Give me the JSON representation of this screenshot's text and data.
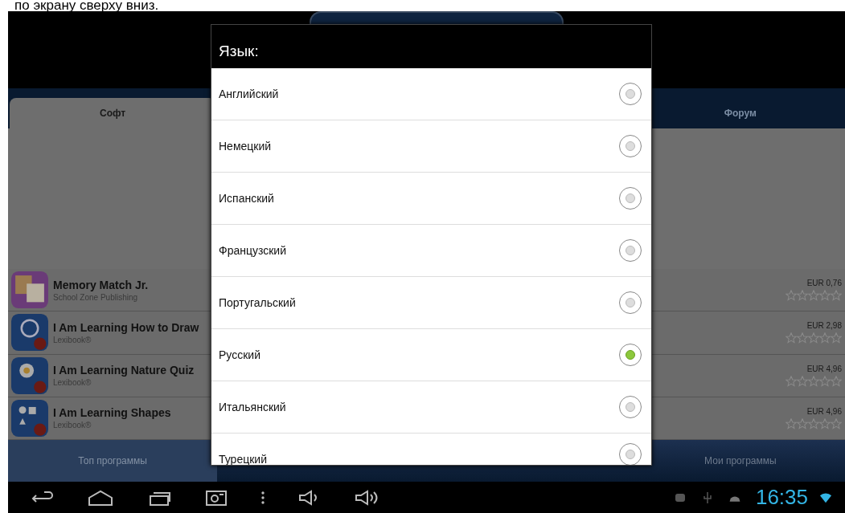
{
  "caption": "по экрану сверху вниз.",
  "tabs": [
    {
      "label": "Софт",
      "selected": true
    },
    {
      "label": "Форум",
      "selected": false
    }
  ],
  "apps": [
    {
      "name": "Memory Match Jr.",
      "publisher": "School Zone Publishing",
      "price": "EUR 0,76",
      "stars": 0,
      "kind": "cards"
    },
    {
      "name": "I Am Learning How to Draw",
      "publisher": "Lexibook®",
      "price": "EUR 2,98",
      "stars": 0,
      "kind": "draw"
    },
    {
      "name": "I Am Learning Nature Quiz",
      "publisher": "Lexibook®",
      "price": "EUR 4,96",
      "stars": 0,
      "kind": "nature"
    },
    {
      "name": "I Am Learning Shapes",
      "publisher": "Lexibook®",
      "price": "EUR 4,96",
      "stars": 0,
      "kind": "shapes"
    }
  ],
  "bottom_tabs": [
    {
      "label": "Топ программы",
      "selected": true
    },
    {
      "label": "Мои программы",
      "selected": false
    }
  ],
  "dialog": {
    "title": "Язык:",
    "options": [
      {
        "label": "Английский",
        "selected": false
      },
      {
        "label": "Немецкий",
        "selected": false
      },
      {
        "label": "Испанский",
        "selected": false
      },
      {
        "label": "Французский",
        "selected": false
      },
      {
        "label": "Португальский",
        "selected": false
      },
      {
        "label": "Русский",
        "selected": true
      },
      {
        "label": "Итальянский",
        "selected": false
      },
      {
        "label": "Турецкий",
        "selected": false
      }
    ]
  },
  "status_bar": {
    "time": "16:35"
  }
}
